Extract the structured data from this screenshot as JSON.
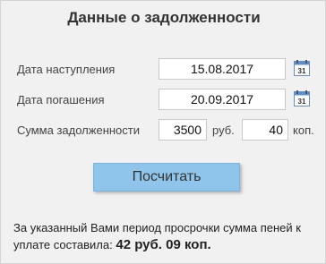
{
  "title": "Данные о задолженности",
  "rows": {
    "start_date": {
      "label": "Дата наступления",
      "value": "15.08.2017",
      "calendar_icon": "calendar-icon",
      "calendar_text": "31"
    },
    "pay_date": {
      "label": "Дата погашения",
      "value": "20.09.2017",
      "calendar_icon": "calendar-icon",
      "calendar_text": "31"
    },
    "debt": {
      "label": "Сумма задолженности",
      "rub_value": "3500",
      "rub_unit": "руб.",
      "kop_value": "40",
      "kop_unit": "коп."
    }
  },
  "button_label": "Посчитать",
  "result": {
    "text": "За указанный Вами период просрочки сумма пеней к уплате составила:",
    "sum": "42 руб. 09 коп."
  },
  "colors": {
    "button": "#8fc5eb",
    "panel": "#f1f1f1"
  }
}
